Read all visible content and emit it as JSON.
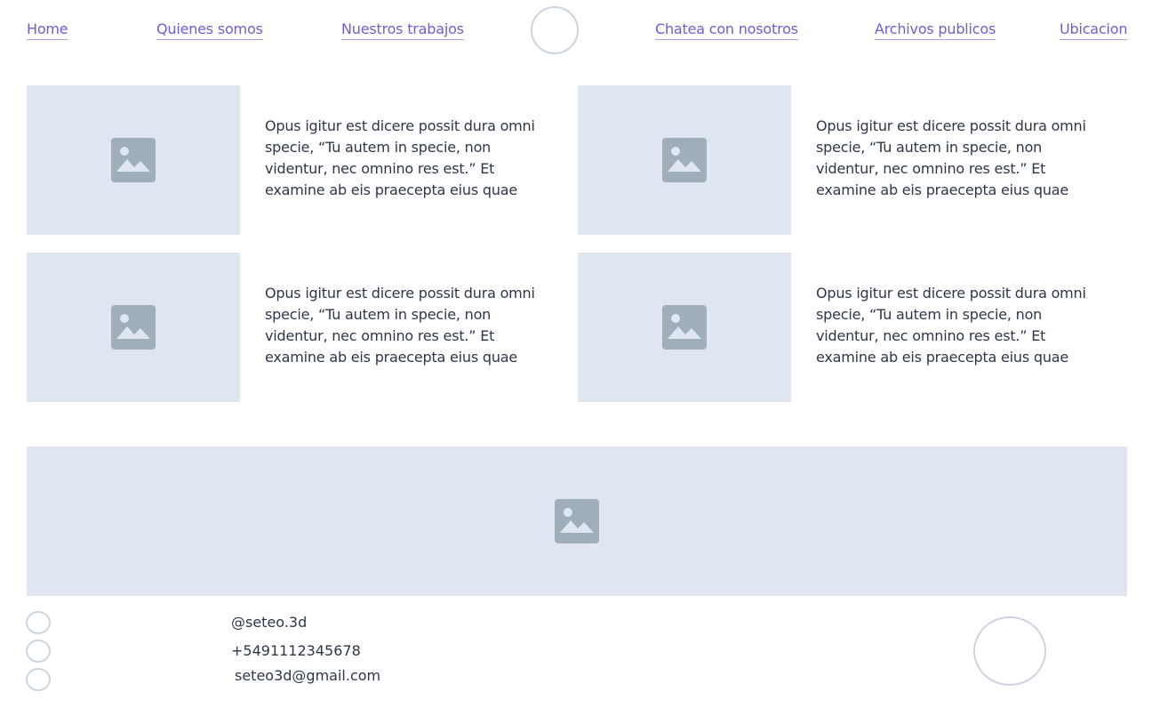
{
  "nav": {
    "items": [
      {
        "label": "Home"
      },
      {
        "label": "Quienes somos"
      },
      {
        "label": "Nuestros trabajos"
      },
      {
        "label": "Chatea con nosotros"
      },
      {
        "label": "Archivos publicos"
      },
      {
        "label": "Ubicacion"
      }
    ]
  },
  "cards": [
    {
      "text": "Opus igitur est dicere possit dura omni specie, “Tu autem in specie, non videntur, nec omnino res est.” Et examine ab eis praecepta eius quae"
    },
    {
      "text": "Opus igitur est dicere possit dura omni specie, “Tu autem in specie, non videntur, nec omnino res est.” Et examine ab eis praecepta eius quae"
    },
    {
      "text": "Opus igitur est dicere possit dura omni specie, “Tu autem in specie, non videntur, nec omnino res est.” Et examine ab eis praecepta eius quae"
    },
    {
      "text": "Opus igitur est dicere possit dura omni specie, “Tu autem in specie, non videntur, nec omnino res est.” Et examine ab eis praecepta eius quae"
    }
  ],
  "footer": {
    "instagram": "@seteo.3d",
    "phone": "+5491112345678",
    "email": "seteo3d@gmail.com"
  },
  "colors": {
    "link": "#6a5fd6",
    "placeholder_bg": "#e0e6ef",
    "placeholder_icon": "#a0aebb",
    "circle_border": "#cbd5e0"
  },
  "icons": [
    "image-placeholder-icon",
    "logo-circle",
    "social-circle-icon"
  ]
}
